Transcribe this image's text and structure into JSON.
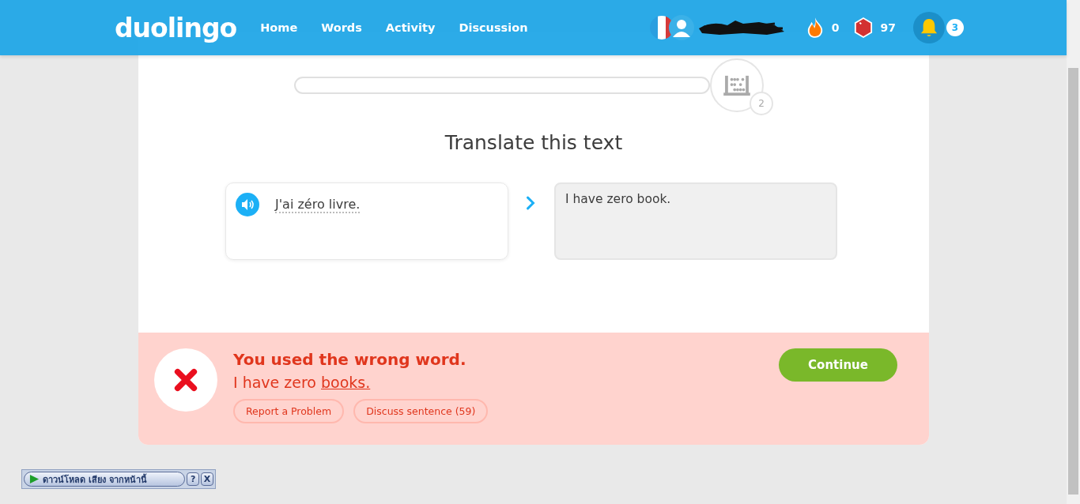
{
  "header": {
    "logo": "duolingo",
    "nav": [
      {
        "label": "Home"
      },
      {
        "label": "Words"
      },
      {
        "label": "Activity"
      },
      {
        "label": "Discussion"
      }
    ],
    "streak": "0",
    "gems": "97",
    "notifications": "3"
  },
  "lesson": {
    "progress": {
      "level": 0
    },
    "checkpoint_badge": "2",
    "title": "Translate this text",
    "prompt": "J'ai zéro livre.",
    "answer": "I have zero book."
  },
  "feedback": {
    "correct": false,
    "heading": "You used the wrong word.",
    "correction": {
      "text": "I have zero",
      "highlight": "books."
    },
    "links": [
      "Report a Problem",
      "Discuss sentence (59)"
    ],
    "continue": "Continue"
  },
  "addon_bar": {
    "label": "ดาวน์โหลด เสียง จากหน้านี้",
    "help": "?",
    "close": "X"
  }
}
